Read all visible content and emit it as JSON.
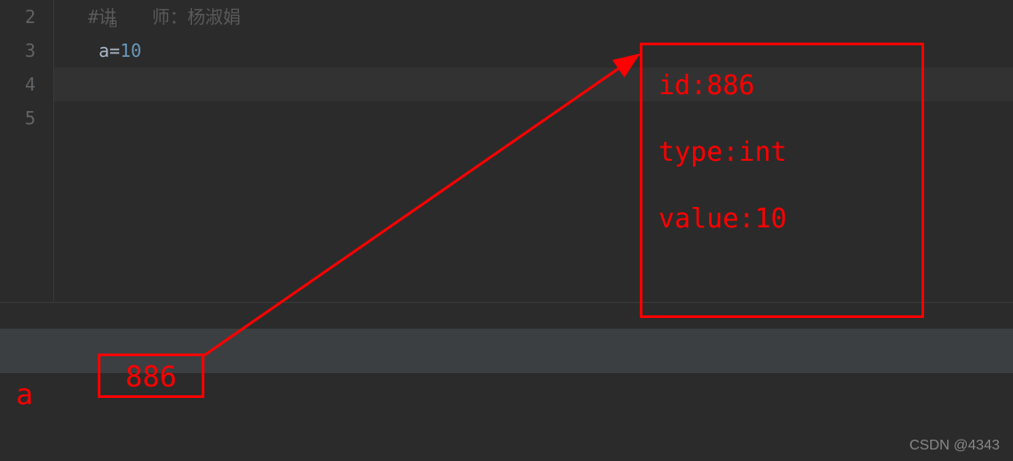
{
  "gutter": {
    "lines": [
      "2",
      "3",
      "4",
      "5"
    ]
  },
  "code": {
    "line2_comment": "#讲　　师：杨淑娟",
    "line3_var": "a",
    "line3_op": "=",
    "line3_val": "10"
  },
  "annotation": {
    "var_label": "a",
    "id_box": "886",
    "detail_id": "id:886",
    "detail_type": "type:int",
    "detail_value": "value:10"
  },
  "watermark": "CSDN @4343"
}
